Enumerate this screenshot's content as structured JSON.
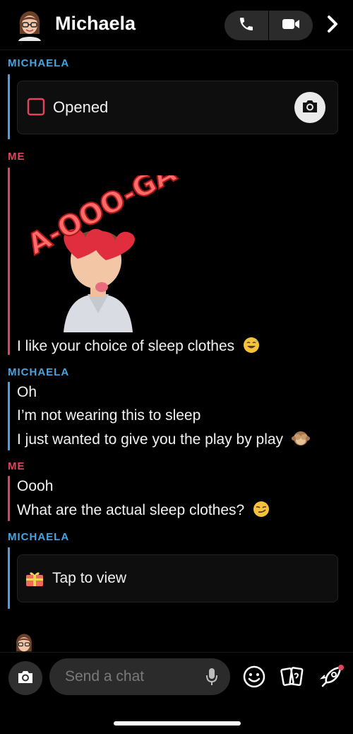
{
  "header": {
    "contact_name": "Michaela"
  },
  "conversation": {
    "sender_them": "MICHAELA",
    "sender_me": "ME",
    "opened_label": "Opened",
    "sticker_text": "A-OOO-GA!",
    "msg_me_1": "I like your choice of sleep clothes",
    "msg_them_1": "Oh",
    "msg_them_2": "I’m not wearing this to sleep",
    "msg_them_3": "I just wanted to give you the play by play",
    "msg_me_2": "Oooh",
    "msg_me_3": "What are the actual sleep clothes?",
    "tap_to_view": "Tap to view"
  },
  "composer": {
    "placeholder": "Send a chat"
  },
  "colors": {
    "them": "#4aa3df",
    "me": "#e0465b",
    "background": "#000000"
  }
}
